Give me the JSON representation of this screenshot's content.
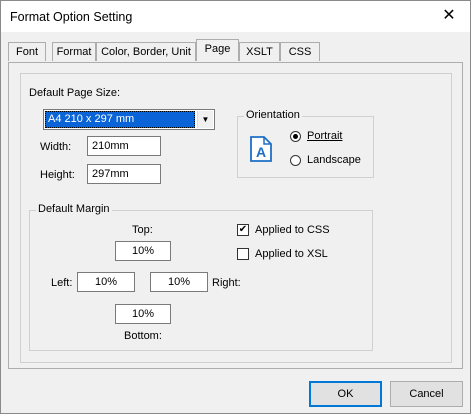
{
  "window": {
    "title": "Format Option Setting",
    "close_glyph": "✕"
  },
  "tabs": [
    {
      "label": "Font"
    },
    {
      "label": "Format"
    },
    {
      "label": "Color, Border, Unit"
    },
    {
      "label": "Page",
      "active": true
    },
    {
      "label": "XSLT"
    },
    {
      "label": "CSS"
    }
  ],
  "page_size": {
    "label": "Default Page Size:",
    "selected": "A4 210 x 297 mm",
    "width_label": "Width:",
    "width_value": "210mm",
    "height_label": "Height:",
    "height_value": "297mm"
  },
  "orientation": {
    "legend": "Orientation",
    "icon": "portrait-page-icon",
    "icon_letter": "A",
    "portrait_label": "Portrait",
    "landscape_label": "Landscape",
    "selected": "Portrait"
  },
  "margin": {
    "legend": "Default Margin",
    "top_label": "Top:",
    "top_value": "10%",
    "left_label": "Left:",
    "left_value": "10%",
    "right_label": "Right:",
    "right_value": "10%",
    "bottom_label": "Bottom:",
    "bottom_value": "10%"
  },
  "options": {
    "applied_css_label": "Applied to CSS",
    "applied_css_checked": true,
    "applied_xsl_label": "Applied to XSL",
    "applied_xsl_checked": false
  },
  "buttons": {
    "ok": "OK",
    "cancel": "Cancel"
  },
  "colors": {
    "selection": "#0a64d8",
    "accent": "#0078d7",
    "icon": "#1e6fc5"
  }
}
